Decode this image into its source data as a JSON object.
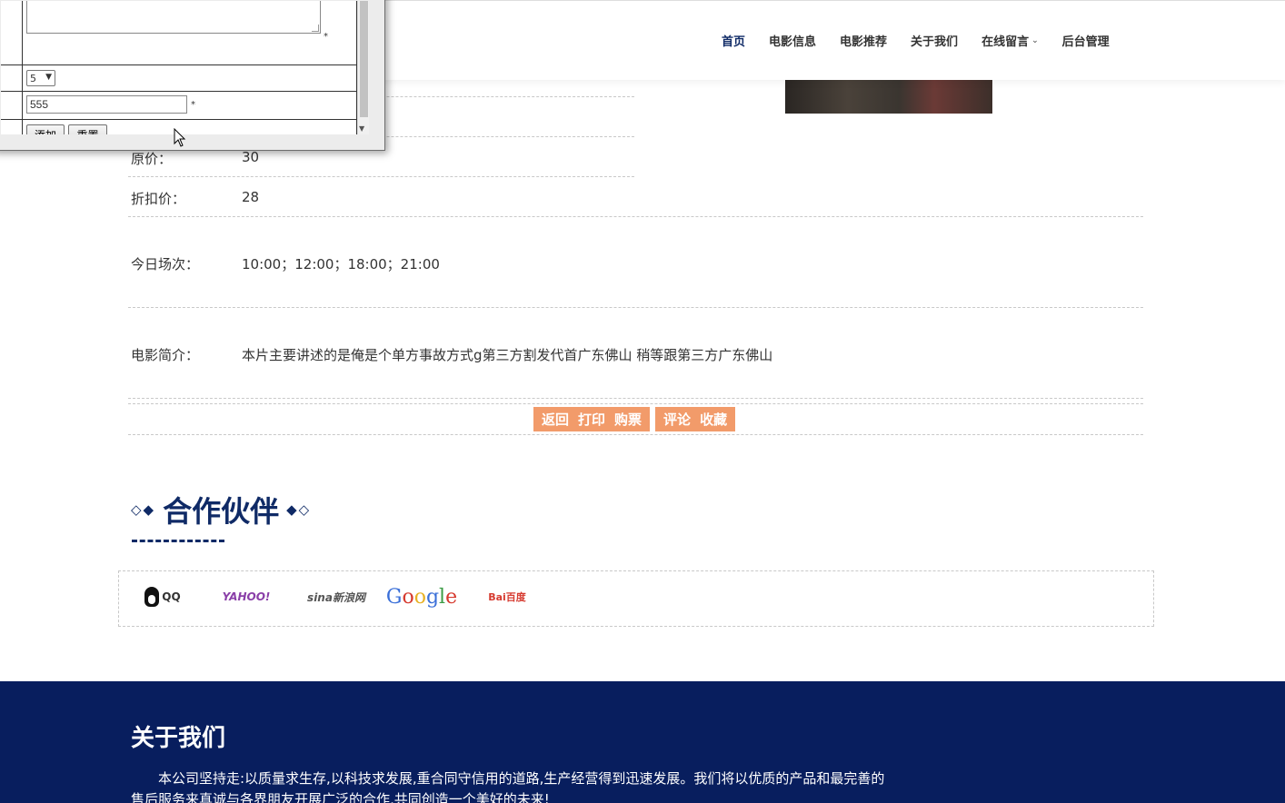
{
  "header": {
    "nav": [
      {
        "label": "首页",
        "active": true
      },
      {
        "label": "电影信息",
        "active": false
      },
      {
        "label": "电影推荐",
        "active": false
      },
      {
        "label": "关于我们",
        "active": false
      },
      {
        "label": "在线留言",
        "active": false,
        "has_dropdown": true
      },
      {
        "label": "后台管理",
        "active": false
      }
    ]
  },
  "details": {
    "original_price": {
      "label": "原价：",
      "value": "30"
    },
    "discount_price": {
      "label": "折扣价：",
      "value": "28"
    },
    "showtimes": {
      "label": "今日场次：",
      "value": "10:00；12:00；18:00；21:00"
    },
    "synopsis": {
      "label": "电影简介：",
      "value": "本片主要讲述的是俺是个单方事故方式g第三方割发代首广东佛山 稍等跟第三方广东佛山"
    }
  },
  "actions": {
    "back": "返回",
    "print": "打印",
    "buy": "购票",
    "comment": "评论",
    "favorite": "收藏"
  },
  "partners": {
    "title": "合作伙伴",
    "left_diamonds": "◇◆",
    "right_diamonds": "◆◇",
    "logos": {
      "qq": "QQ",
      "yahoo": "YAHOO!",
      "sina": "sina新浪网",
      "google": "Google",
      "baidu": "Bai百度"
    }
  },
  "footer": {
    "title": "关于我们",
    "text": "本公司坚持走:以质量求生存,以科技求发展,重合同守信用的道路,生产经营得到迅速发展。我们将以优质的产品和最完善的售后服务来真诚与各界朋友开展广泛的合作,共同创造一个美好的未来!"
  },
  "popup": {
    "select_value": "5",
    "input_value": "555",
    "required_mark": "*",
    "add_button": "添加",
    "reset_button": "重置"
  },
  "colors": {
    "brand_navy": "#0f2a66",
    "footer_bg": "#081e5e",
    "action_orange": "#f29b6a"
  }
}
